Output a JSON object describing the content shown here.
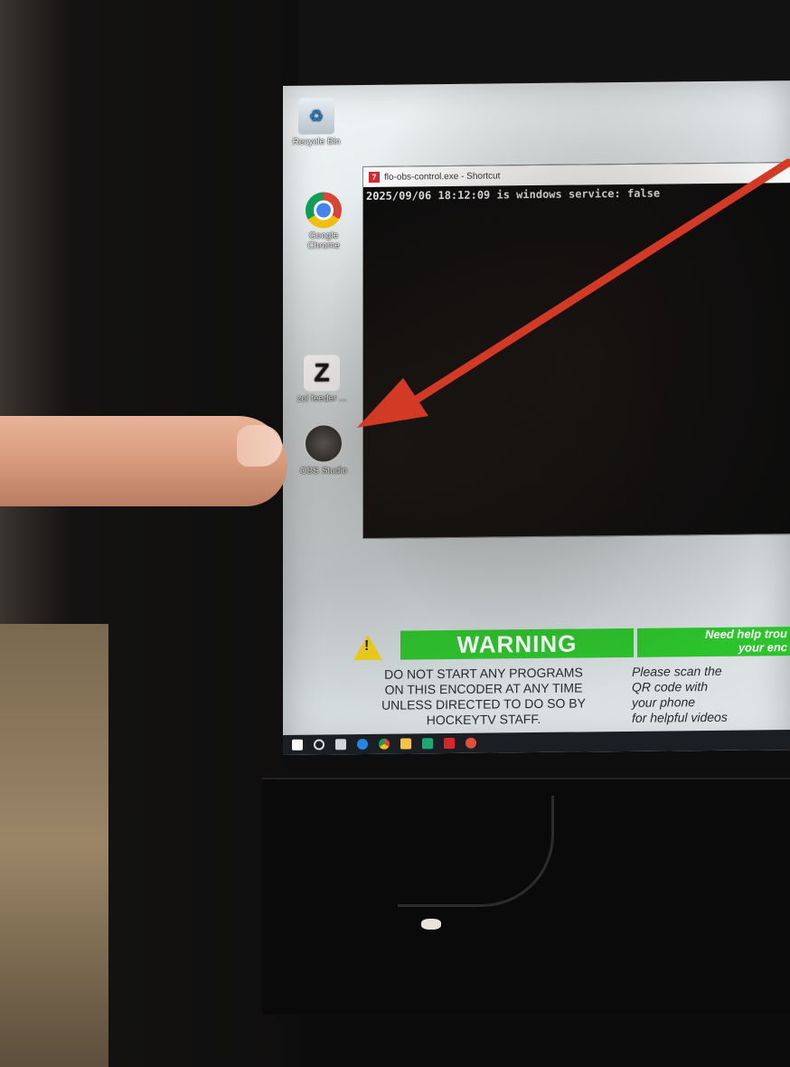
{
  "desktop": {
    "icons": [
      {
        "label": "Recycle Bin",
        "icon": "recycle-bin-icon"
      },
      {
        "label": "Google Chrome",
        "icon": "chrome-icon"
      },
      {
        "label": "zoi feeder ...",
        "icon": "zoi-feeder-icon"
      },
      {
        "label": "OBS Studio",
        "icon": "obs-studio-icon"
      }
    ]
  },
  "console": {
    "title": "flo-obs-control.exe - Shortcut",
    "line": "2025/09/06 18:12:09 is windows service: false"
  },
  "warning": {
    "title": "WARNING",
    "lines": [
      "DO NOT START ANY PROGRAMS",
      "ON THIS ENCODER AT ANY TIME",
      "UNLESS DIRECTED TO DO SO BY",
      "HOCKEYTV STAFF."
    ],
    "help_title_1": "Need help trou",
    "help_title_2": "your enc",
    "help_lines": [
      "Please scan the",
      "QR code with",
      "your phone",
      "for helpful videos"
    ]
  },
  "colors": {
    "arrow": "#d23a26",
    "banner_green": "#2cc32c",
    "warning_yellow": "#f1d11a"
  }
}
